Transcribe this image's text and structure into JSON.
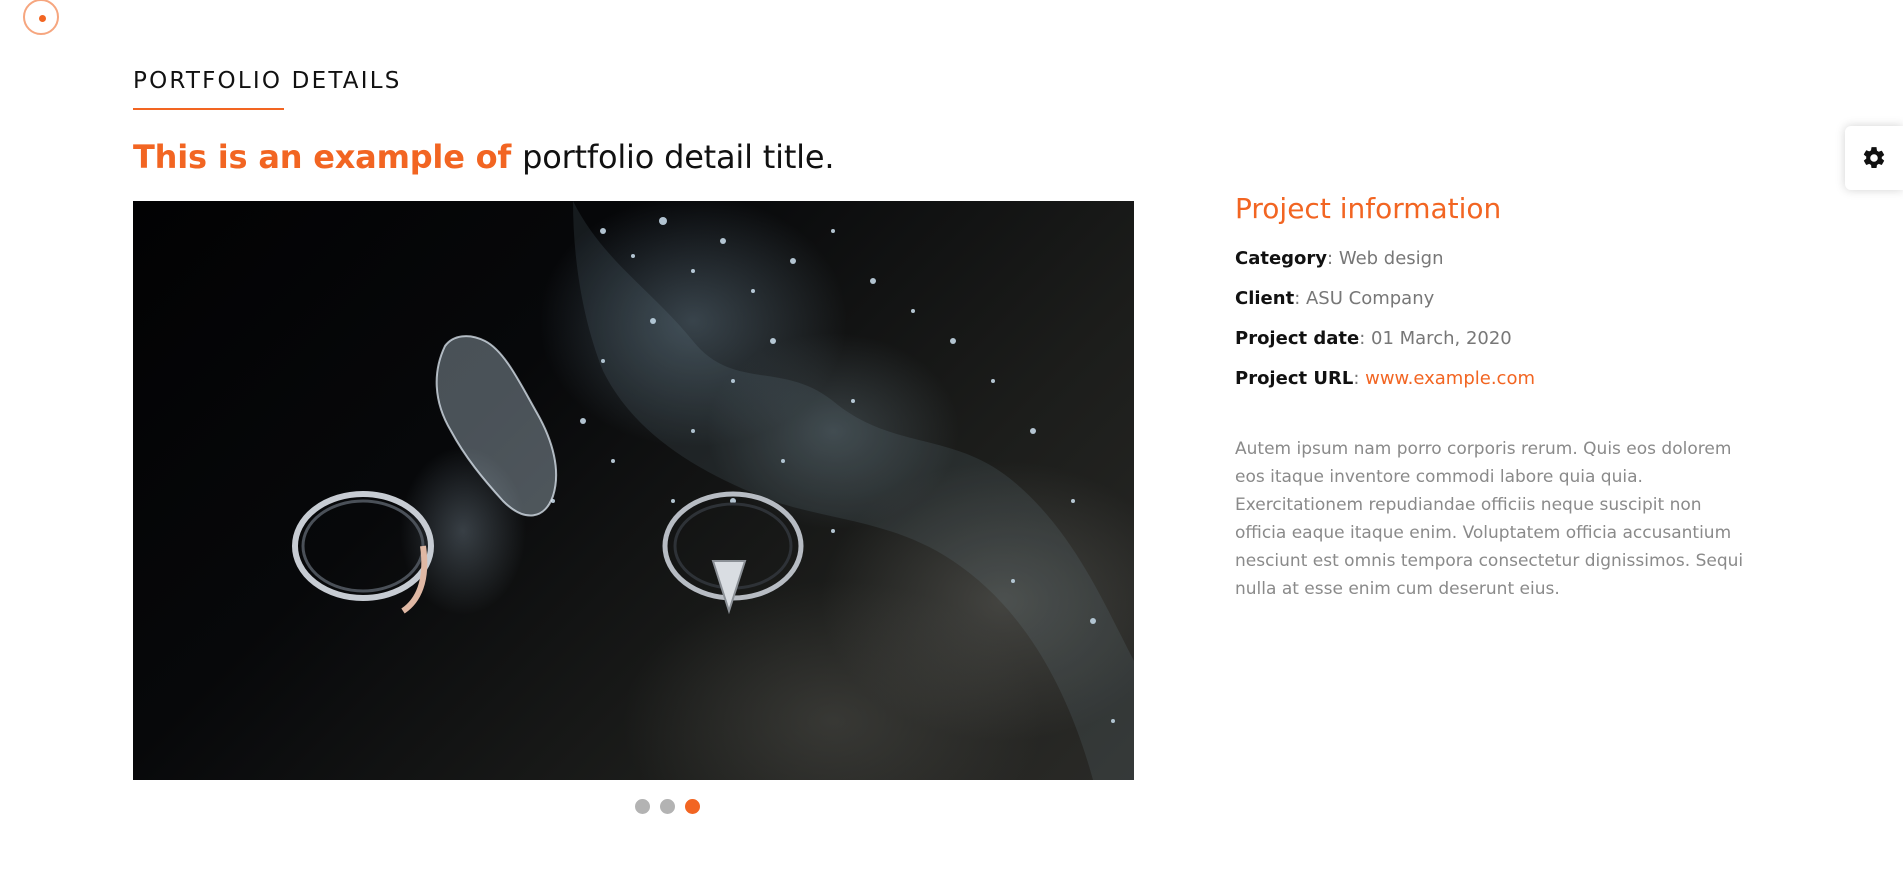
{
  "section": {
    "heading": "PORTFOLIO DETAILS"
  },
  "title": {
    "accent": "This is an example of",
    "rest": "portfolio detail title."
  },
  "slider": {
    "slides": 3,
    "active_slide": 3
  },
  "project_info": {
    "heading": "Project information",
    "rows": [
      {
        "key": "Category",
        "value": "Web design"
      },
      {
        "key": "Client",
        "value": "ASU Company"
      },
      {
        "key": "Project date",
        "value": "01 March, 2020"
      },
      {
        "key": "Project URL",
        "value": "www.example.com"
      }
    ],
    "description": "Autem ipsum nam porro corporis rerum. Quis eos dolorem eos itaque inventore commodi labore quia quia. Exercitationem repudiandae officiis neque suscipit non officia eaque itaque enim. Voluptatem officia accusantium nesciunt est omnis tempora consectetur dignissimos. Sequi nulla at esse enim cum deserunt eius."
  },
  "colors": {
    "accent": "#f26522",
    "muted_text": "#8a8a8a",
    "dot_inactive": "#b3b3b3"
  },
  "icons": {
    "settings": "gear-icon",
    "cursor": "cursor-ring-icon"
  }
}
